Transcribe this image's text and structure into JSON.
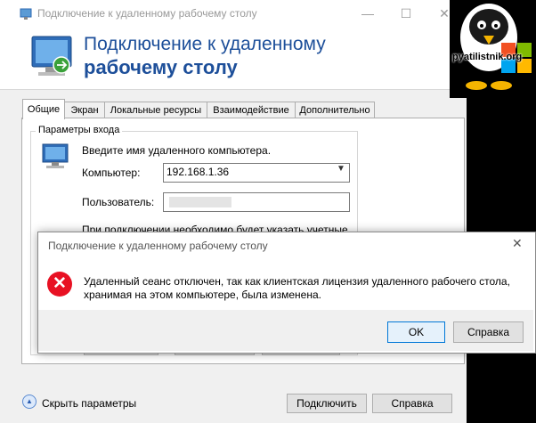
{
  "window": {
    "title": "Подключение к удаленному рабочему столу",
    "minimize_icon": "—",
    "maximize_icon": "☐",
    "close_icon": "✕"
  },
  "banner": {
    "line1": "Подключение к удаленному",
    "line2": "рабочему столу"
  },
  "watermark": "pyatilistnik.org",
  "tabs": [
    {
      "label": "Общие",
      "active": true
    },
    {
      "label": "Экран",
      "active": false
    },
    {
      "label": "Локальные ресурсы",
      "active": false
    },
    {
      "label": "Взаимодействие",
      "active": false
    },
    {
      "label": "Дополнительно",
      "active": false
    }
  ],
  "login": {
    "group_label": "Параметры входа",
    "instruction": "Введите имя удаленного компьютера.",
    "computer_label": "Компьютер:",
    "computer_value": "192.168.1.36",
    "user_label": "Пользователь:",
    "user_value": "",
    "note": "При подключении необходимо будет указать учетные"
  },
  "bottom": {
    "show_options": "Скрыть параметры",
    "connect": "Подключить",
    "help": "Справка"
  },
  "dialog": {
    "title": "Подключение к удаленному рабочему столу",
    "close_icon": "✕",
    "error_icon": "✕",
    "message_line1": "Удаленный сеанс отключен, так как клиентская лицензия удаленного рабочего стола,",
    "message_line2": "хранимая на этом компьютере, была изменена.",
    "ok_label": "OK",
    "help_label": "Справка"
  },
  "colors": {
    "banner_text": "#1d4f9a",
    "error": "#e81123",
    "default_button_border": "#0078d7"
  }
}
